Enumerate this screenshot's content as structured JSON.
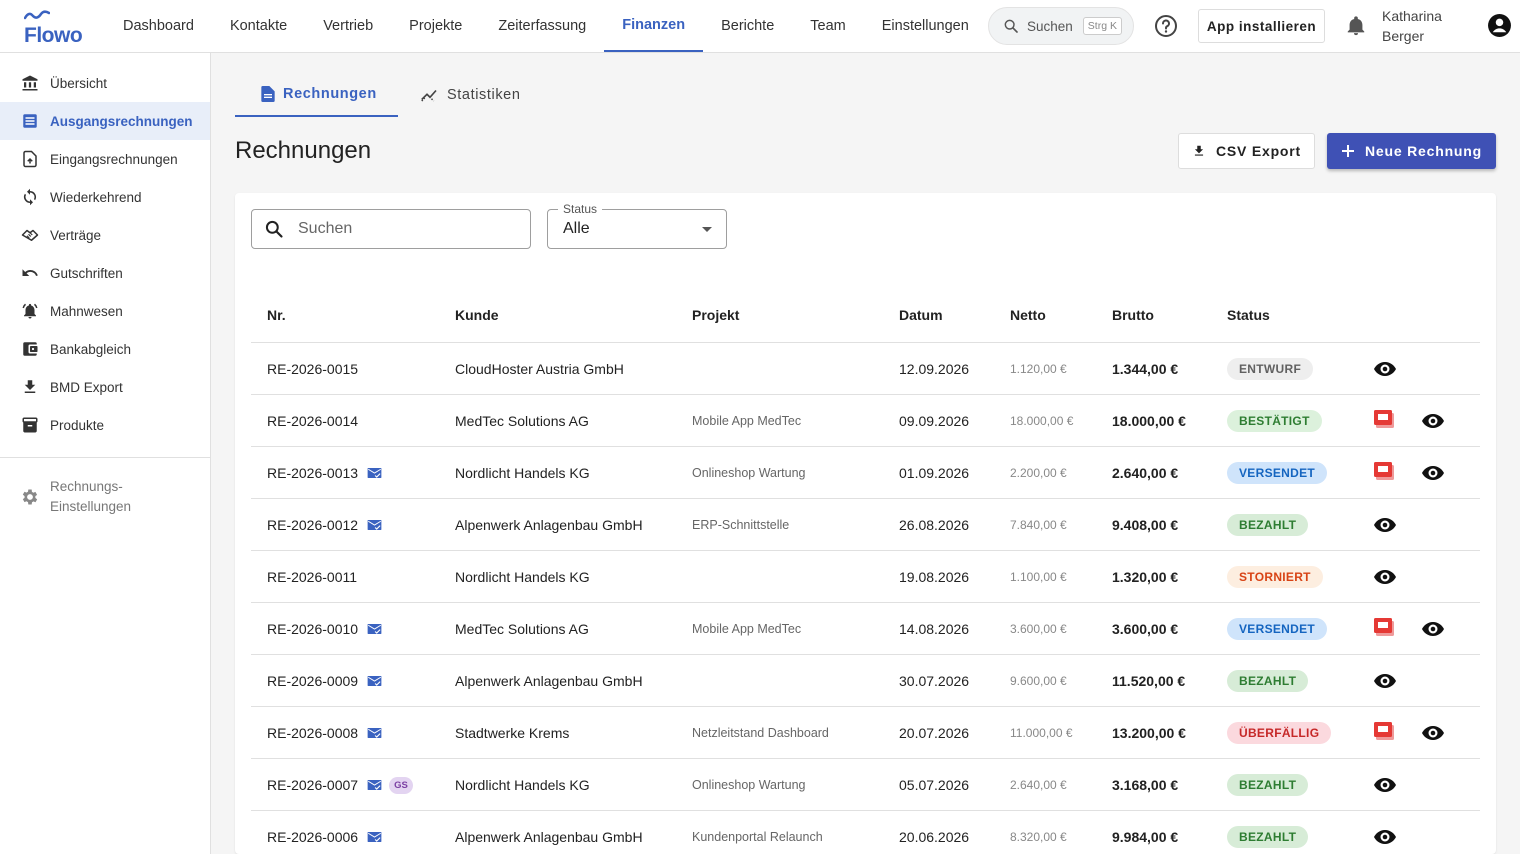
{
  "app": {
    "logo_text": "Flowo",
    "brand_color": "#3a62c0",
    "primary_color": "#3f51b5"
  },
  "header": {
    "nav": [
      {
        "label": "Dashboard"
      },
      {
        "label": "Kontakte"
      },
      {
        "label": "Vertrieb"
      },
      {
        "label": "Projekte"
      },
      {
        "label": "Zeiterfassung"
      },
      {
        "label": "Finanzen",
        "active": true
      },
      {
        "label": "Berichte"
      },
      {
        "label": "Team"
      },
      {
        "label": "Einstellungen"
      }
    ],
    "search_label": "Suchen",
    "search_shortcut": "Strg K",
    "install_label": "App installieren",
    "user_name": "Katharina Berger"
  },
  "sidebar": {
    "items": [
      {
        "label": "Übersicht",
        "icon": "bank-icon"
      },
      {
        "label": "Ausgangsrechnungen",
        "icon": "invoice-list-icon",
        "active": true
      },
      {
        "label": "Eingangsrechnungen",
        "icon": "file-upload-icon"
      },
      {
        "label": "Wiederkehrend",
        "icon": "repeat-icon"
      },
      {
        "label": "Verträge",
        "icon": "handshake-icon"
      },
      {
        "label": "Gutschriften",
        "icon": "undo-icon"
      },
      {
        "label": "Mahnwesen",
        "icon": "alarm-bell-icon"
      },
      {
        "label": "Bankabgleich",
        "icon": "wallet-icon"
      },
      {
        "label": "BMD Export",
        "icon": "download-icon"
      },
      {
        "label": "Produkte",
        "icon": "inventory-icon"
      }
    ],
    "settings_label_line1": "Rechnungs-",
    "settings_label_line2": "Einstellungen"
  },
  "main": {
    "tabs": [
      {
        "label": "Rechnungen",
        "active": true
      },
      {
        "label": "Statistiken"
      }
    ],
    "title": "Rechnungen",
    "csv_label": "CSV Export",
    "new_label": "Neue Rechnung",
    "search_placeholder": "Suchen",
    "status_filter": {
      "legend": "Status",
      "value": "Alle"
    }
  },
  "table": {
    "columns": [
      "Nr.",
      "Kunde",
      "Projekt",
      "Datum",
      "Netto",
      "Brutto",
      "Status"
    ],
    "rows": [
      {
        "nr": "RE-2026-0015",
        "mail": false,
        "gs": false,
        "kunde": "CloudHoster Austria GmbH",
        "projekt": "",
        "datum": "12.09.2026",
        "netto": "1.120,00 €",
        "brutto": "1.344,00 €",
        "status": "ENTWURF",
        "pdf": false
      },
      {
        "nr": "RE-2026-0014",
        "mail": false,
        "gs": false,
        "kunde": "MedTec Solutions AG",
        "projekt": "Mobile App MedTec",
        "datum": "09.09.2026",
        "netto": "18.000,00 €",
        "brutto": "18.000,00 €",
        "status": "BESTÄTIGT",
        "pdf": true
      },
      {
        "nr": "RE-2026-0013",
        "mail": true,
        "gs": false,
        "kunde": "Nordlicht Handels KG",
        "projekt": "Onlineshop Wartung",
        "datum": "01.09.2026",
        "netto": "2.200,00 €",
        "brutto": "2.640,00 €",
        "status": "VERSENDET",
        "pdf": true
      },
      {
        "nr": "RE-2026-0012",
        "mail": true,
        "gs": false,
        "kunde": "Alpenwerk Anlagenbau GmbH",
        "projekt": "ERP-Schnittstelle",
        "datum": "26.08.2026",
        "netto": "7.840,00 €",
        "brutto": "9.408,00 €",
        "status": "BEZAHLT",
        "pdf": false
      },
      {
        "nr": "RE-2026-0011",
        "mail": false,
        "gs": false,
        "kunde": "Nordlicht Handels KG",
        "projekt": "",
        "datum": "19.08.2026",
        "netto": "1.100,00 €",
        "brutto": "1.320,00 €",
        "status": "STORNIERT",
        "pdf": false
      },
      {
        "nr": "RE-2026-0010",
        "mail": true,
        "gs": false,
        "kunde": "MedTec Solutions AG",
        "projekt": "Mobile App MedTec",
        "datum": "14.08.2026",
        "netto": "3.600,00 €",
        "brutto": "3.600,00 €",
        "status": "VERSENDET",
        "pdf": true
      },
      {
        "nr": "RE-2026-0009",
        "mail": true,
        "gs": false,
        "kunde": "Alpenwerk Anlagenbau GmbH",
        "projekt": "",
        "datum": "30.07.2026",
        "netto": "9.600,00 €",
        "brutto": "11.520,00 €",
        "status": "BEZAHLT",
        "pdf": false
      },
      {
        "nr": "RE-2026-0008",
        "mail": true,
        "gs": false,
        "kunde": "Stadtwerke Krems",
        "projekt": "Netzleitstand Dashboard",
        "datum": "20.07.2026",
        "netto": "11.000,00 €",
        "brutto": "13.200,00 €",
        "status": "ÜBERFÄLLIG",
        "pdf": true
      },
      {
        "nr": "RE-2026-0007",
        "mail": true,
        "gs": true,
        "gs_label": "GS",
        "kunde": "Nordlicht Handels KG",
        "projekt": "Onlineshop Wartung",
        "datum": "05.07.2026",
        "netto": "2.640,00 €",
        "brutto": "3.168,00 €",
        "status": "BEZAHLT",
        "pdf": false
      },
      {
        "nr": "RE-2026-0006",
        "mail": true,
        "gs": false,
        "kunde": "Alpenwerk Anlagenbau GmbH",
        "projekt": "Kundenportal Relaunch",
        "datum": "20.06.2026",
        "netto": "8.320,00 €",
        "brutto": "9.984,00 €",
        "status": "BEZAHLT",
        "pdf": false
      }
    ]
  },
  "status_colors": {
    "ENTWURF": {
      "bg": "#eeeeee",
      "fg": "#616161"
    },
    "BESTÄTIGT": {
      "bg": "#dcf1dc",
      "fg": "#2e7d32"
    },
    "VERSENDET": {
      "bg": "#cfe4fb",
      "fg": "#1565c0"
    },
    "BEZAHLT": {
      "bg": "#d7ecd7",
      "fg": "#2e7d32"
    },
    "STORNIERT": {
      "bg": "#fdeee0",
      "fg": "#d84315"
    },
    "ÜBERFÄLLIG": {
      "bg": "#fbd9de",
      "fg": "#c62828"
    }
  }
}
